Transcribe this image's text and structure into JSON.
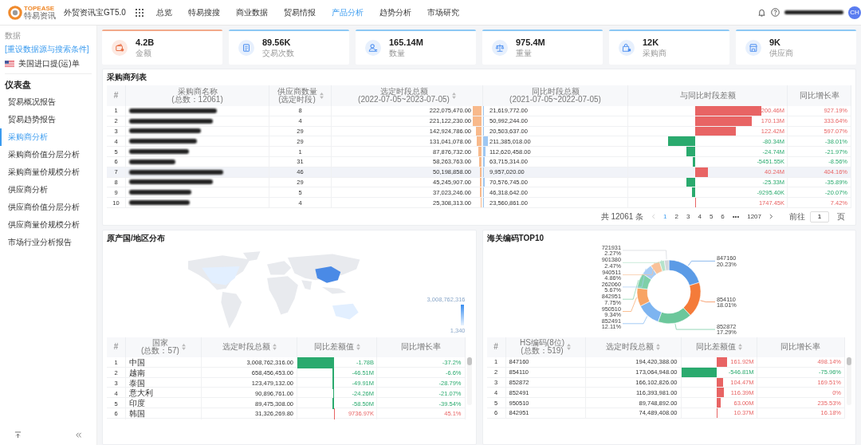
{
  "brand": {
    "logo_word": "TOPEASE",
    "logo_sub": "特易资讯",
    "product": "外贸资讯宝GT5.0"
  },
  "nav": [
    {
      "label": "总览",
      "selected": false
    },
    {
      "label": "特易搜搜",
      "selected": false
    },
    {
      "label": "商业数据",
      "selected": false
    },
    {
      "label": "贸易情报",
      "selected": false
    },
    {
      "label": "产品分析",
      "selected": true
    },
    {
      "label": "趋势分析",
      "selected": false
    },
    {
      "label": "市场研究",
      "selected": false
    }
  ],
  "user": {
    "avatar": "CH"
  },
  "sidebar": {
    "section": "数据",
    "reset_link": "[重设数据源与搜索条件]",
    "dataset": "美国进口提(运)单",
    "heading": "仪表盘",
    "items": [
      {
        "label": "贸易概况报告",
        "selected": false
      },
      {
        "label": "贸易趋势报告",
        "selected": false
      },
      {
        "label": "采购商分析",
        "selected": true
      },
      {
        "label": "采购商价值分层分析",
        "selected": false
      },
      {
        "label": "采购商量价规模分析",
        "selected": false
      },
      {
        "label": "供应商分析",
        "selected": false
      },
      {
        "label": "供应商价值分层分析",
        "selected": false
      },
      {
        "label": "供应商量价规模分析",
        "selected": false
      },
      {
        "label": "市场行业分析报告",
        "selected": false
      }
    ]
  },
  "kpis": [
    {
      "value": "4.2B",
      "label": "金额",
      "selected": true
    },
    {
      "value": "89.56K",
      "label": "交易次数",
      "selected": false
    },
    {
      "value": "165.14M",
      "label": "数量",
      "selected": false
    },
    {
      "value": "975.4M",
      "label": "重量",
      "selected": false
    },
    {
      "value": "12K",
      "label": "采购商",
      "selected": false
    },
    {
      "value": "9K",
      "label": "供应商",
      "selected": false
    }
  ],
  "buyer_table": {
    "title": "采购商列表",
    "columns": [
      {
        "label": "#"
      },
      {
        "label": "采购商名称",
        "sub": "(总数：12061)"
      },
      {
        "label": "供应商数量",
        "sub": "(选定时段)",
        "sortable": true
      },
      {
        "label": "选定时段总额",
        "sub": "(2022-07-05~2023-07-05)",
        "sortable": true
      },
      {
        "label": "同比时段总额",
        "sub": "(2021-07-05~2022-07-05)"
      },
      {
        "label": "与同比时段差额"
      },
      {
        "label": "同比增长率"
      }
    ],
    "rows": [
      {
        "index": "1",
        "suppliers": "8",
        "amount": "222,075,470.00",
        "previous": "21,619,772.00",
        "diff": "200.46M",
        "rate": "927.19%",
        "selected": false
      },
      {
        "index": "2",
        "suppliers": "4",
        "amount": "221,122,230.00",
        "previous": "50,992,244.00",
        "diff": "170.13M",
        "rate": "333.64%",
        "selected": false
      },
      {
        "index": "3",
        "suppliers": "29",
        "amount": "142,924,786.00",
        "previous": "20,503,637.00",
        "diff": "122.42M",
        "rate": "597.07%",
        "selected": false
      },
      {
        "index": "4",
        "suppliers": "29",
        "amount": "131,041,078.00",
        "previous": "211,385,018.00",
        "diff": "-80.34M",
        "rate": "-38.01%",
        "selected": false
      },
      {
        "index": "5",
        "suppliers": "1",
        "amount": "87,876,732.00",
        "previous": "112,620,458.00",
        "diff": "-24.74M",
        "rate": "-21.97%",
        "selected": false
      },
      {
        "index": "6",
        "suppliers": "31",
        "amount": "58,263,763.00",
        "previous": "63,715,314.00",
        "diff": "-5451.55K",
        "rate": "-8.56%",
        "selected": false
      },
      {
        "index": "7",
        "suppliers": "46",
        "amount": "50,198,858.00",
        "previous": "9,957,020.00",
        "diff": "40.24M",
        "rate": "404.16%",
        "selected": true
      },
      {
        "index": "8",
        "suppliers": "29",
        "amount": "45,245,907.00",
        "previous": "70,576,745.00",
        "diff": "-25.33M",
        "rate": "-35.89%",
        "selected": false
      },
      {
        "index": "9",
        "suppliers": "5",
        "amount": "37,023,246.00",
        "previous": "46,318,642.00",
        "diff": "-9295.40K",
        "rate": "-20.07%",
        "selected": false
      },
      {
        "index": "10",
        "suppliers": "4",
        "amount": "25,308,313.00",
        "previous": "23,560,861.00",
        "diff": "1747.45K",
        "rate": "7.42%",
        "selected": false
      }
    ],
    "pagination": {
      "total": "共 12061 条",
      "pages": [
        {
          "label": "1",
          "selected": true
        },
        {
          "label": "2",
          "selected": false
        },
        {
          "label": "3",
          "selected": false
        },
        {
          "label": "4",
          "selected": false
        },
        {
          "label": "5",
          "selected": false
        },
        {
          "label": "6",
          "selected": false
        }
      ],
      "ellipsis": "•••",
      "last": "1207",
      "goto_label": "前往",
      "goto_value": "1",
      "goto_unit": "页"
    }
  },
  "origin_panel": {
    "title": "原产国/地区分布",
    "legend_max": "3,008,762,316",
    "legend_min": "1,340",
    "columns": [
      {
        "label": "#"
      },
      {
        "label": "国家",
        "sub": "(总数：57)",
        "sortable": true
      },
      {
        "label": "选定时段总额",
        "sortable": true
      },
      {
        "label": "同比差额值",
        "sortable": true
      },
      {
        "label": "同比增长率"
      }
    ],
    "rows": [
      {
        "index": "1",
        "name": "中国",
        "amount": "3,008,762,316.00",
        "diff": "-1.78B",
        "rate": "-37.2%"
      },
      {
        "index": "2",
        "name": "越南",
        "amount": "658,456,453.00",
        "diff": "-46.51M",
        "rate": "-6.6%"
      },
      {
        "index": "3",
        "name": "泰国",
        "amount": "123,479,132.00",
        "diff": "-49.91M",
        "rate": "-28.79%"
      },
      {
        "index": "4",
        "name": "意大利",
        "amount": "90,896,761.00",
        "diff": "-24.26M",
        "rate": "-21.07%"
      },
      {
        "index": "5",
        "name": "印度",
        "amount": "89,475,308.00",
        "diff": "-58.50M",
        "rate": "-39.54%"
      },
      {
        "index": "6",
        "name": "韩国",
        "amount": "31,326,269.80",
        "diff": "9736.97K",
        "rate": "45.1%"
      }
    ]
  },
  "hs_panel": {
    "title": "海关编码TOP10",
    "chart_data": {
      "type": "donut",
      "categories": [
        "847160",
        "854110",
        "852872",
        "852491",
        "950510",
        "842951",
        "262060",
        "940511",
        "901380",
        "721931"
      ],
      "values": [
        20.23,
        18.01,
        17.29,
        12.11,
        9.34,
        7.75,
        5.67,
        4.86,
        2.47,
        2.27
      ],
      "colors": [
        "#5b9be6",
        "#f47b3a",
        "#6cc79b",
        "#7db4f0",
        "#f8a464",
        "#7fd0a8",
        "#a9cdf5",
        "#f9c299",
        "#b5e3cb",
        "#d3d6db"
      ],
      "data_labels": true,
      "value_labels": [
        "20.23%",
        "18.01%",
        "17.29%",
        "12.11%",
        "9.34%",
        "7.75%",
        "5.67%",
        "4.86%",
        "2.47%",
        "2.27%"
      ]
    },
    "columns": [
      {
        "label": "#"
      },
      {
        "label": "HS编码(8位)",
        "sub": "(总数：519)",
        "sortable": true
      },
      {
        "label": "选定时段总额",
        "sortable": true
      },
      {
        "label": "同比差额值",
        "sortable": true
      },
      {
        "label": "同比增长率"
      }
    ],
    "rows": [
      {
        "index": "1",
        "name": "847160",
        "amount": "194,420,388.00",
        "diff": "161.92M",
        "rate": "498.14%"
      },
      {
        "index": "2",
        "name": "854110",
        "amount": "173,064,948.00",
        "diff": "-546.81M",
        "rate": "-75.96%"
      },
      {
        "index": "3",
        "name": "852872",
        "amount": "166,102,826.00",
        "diff": "104.47M",
        "rate": "169.51%"
      },
      {
        "index": "4",
        "name": "852491",
        "amount": "116,393,981.00",
        "diff": "116.39M",
        "rate": "0%"
      },
      {
        "index": "5",
        "name": "950510",
        "amount": "89,748,892.00",
        "diff": "63.00M",
        "rate": "235.53%"
      },
      {
        "index": "6",
        "name": "842951",
        "amount": "74,489,408.00",
        "diff": "10.37M",
        "rate": "16.18%"
      }
    ]
  }
}
